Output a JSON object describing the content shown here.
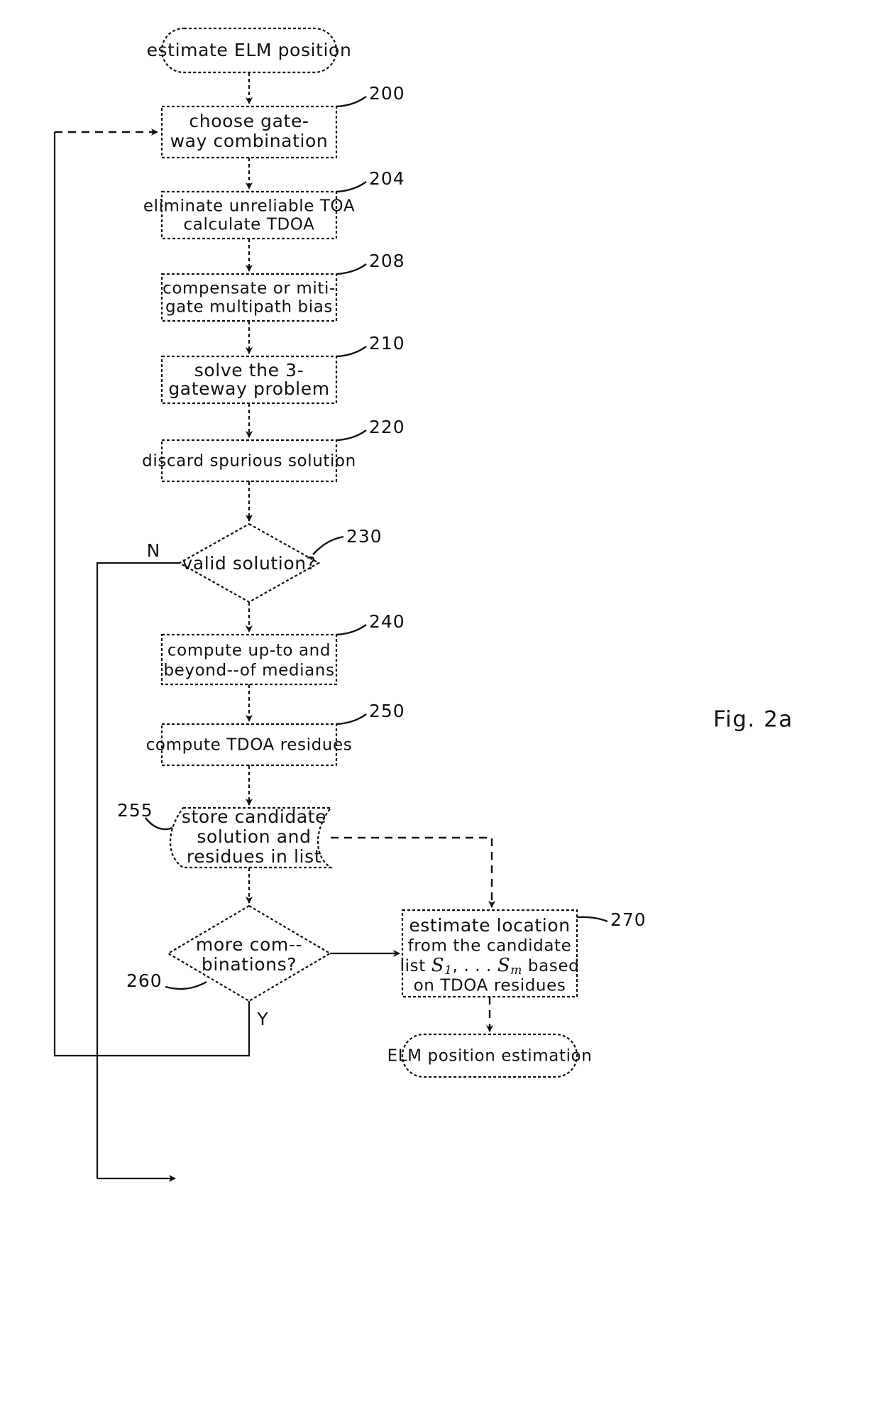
{
  "figure": {
    "caption": "Fig. 2a"
  },
  "nodes": {
    "start": {
      "id": "start",
      "shape": "rounded-terminal",
      "label": "estimate ELM position"
    },
    "n200": {
      "id": "200",
      "shape": "process",
      "ref": "200",
      "line1": "choose gate-",
      "line2": "way combination"
    },
    "n204": {
      "id": "204",
      "shape": "process",
      "ref": "204",
      "line1": "eliminate unreliable TOA",
      "line2": "calculate TDOA"
    },
    "n208": {
      "id": "208",
      "shape": "process",
      "ref": "208",
      "line1": "compensate or miti-",
      "line2": "gate multipath bias"
    },
    "n210": {
      "id": "210",
      "shape": "process",
      "ref": "210",
      "line1": "solve the 3-",
      "line2": "gateway problem"
    },
    "n220": {
      "id": "220",
      "shape": "process",
      "ref": "220",
      "line1": "discard spurious solution",
      "line2": ""
    },
    "n230": {
      "id": "230",
      "shape": "decision",
      "ref": "230",
      "label": "valid solution?",
      "branch_no": "N"
    },
    "n240": {
      "id": "240",
      "shape": "process",
      "ref": "240",
      "line1": "compute up-to and",
      "line2": "beyond--of medians"
    },
    "n250": {
      "id": "250",
      "shape": "process",
      "ref": "250",
      "line1": "compute TDOA residues",
      "line2": ""
    },
    "n255": {
      "id": "255",
      "shape": "stored-data",
      "ref": "255",
      "line1": "store candidate",
      "line2": "solution and",
      "line3": "residues in list"
    },
    "n260": {
      "id": "260",
      "shape": "decision",
      "ref": "260",
      "line1": "more com--",
      "line2": "binations?",
      "branch_yes": "Y"
    },
    "n270": {
      "id": "270",
      "shape": "process",
      "ref": "270",
      "line1": "estimate location",
      "line2": "from the candidate",
      "line3_pre": "list ",
      "line3_math_s1": "S",
      "line3_math_sub1": "1",
      "line3_math_sep": ", . . . ",
      "line3_math_s2": "S",
      "line3_math_sub2": "m",
      "line3_post": " based",
      "line4": "on TDOA residues"
    },
    "end": {
      "id": "end",
      "shape": "rounded-terminal",
      "label": "ELM position estimation"
    }
  },
  "colors": {
    "stroke": "#111111",
    "background": "#ffffff"
  }
}
